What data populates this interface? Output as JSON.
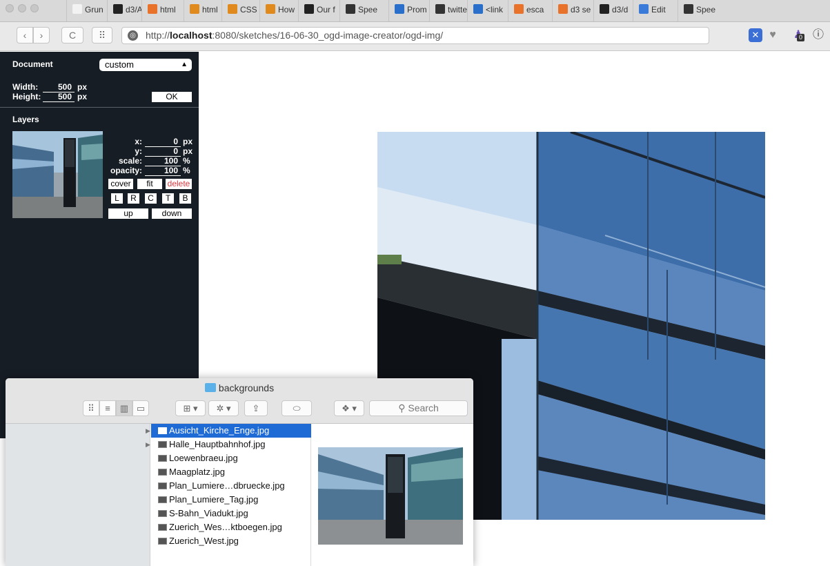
{
  "tabs": [
    {
      "label": "Grun",
      "icon": "document-icon",
      "color": "#f2f2f2"
    },
    {
      "label": "d3/A",
      "icon": "github-icon",
      "color": "#222222"
    },
    {
      "label": "html",
      "icon": "firefox-icon",
      "color": "#e8722a"
    },
    {
      "label": "html",
      "icon": "stackoverflow-icon",
      "color": "#e08a1e"
    },
    {
      "label": "CSS",
      "icon": "stackoverflow-icon",
      "color": "#e08a1e"
    },
    {
      "label": "How",
      "icon": "stackoverflow-icon",
      "color": "#e08a1e"
    },
    {
      "label": "Our f",
      "icon": "code-icon",
      "color": "#222222"
    },
    {
      "label": "Spee",
      "icon": "grid-icon",
      "color": "#333333"
    },
    {
      "label": "Prom",
      "icon": "square-icon",
      "color": "#2a6fc9"
    },
    {
      "label": "twitte",
      "icon": "letter-c-icon",
      "color": "#333333"
    },
    {
      "label": "<link",
      "icon": "square-icon",
      "color": "#2a6fc9"
    },
    {
      "label": "esca",
      "icon": "firefox-icon",
      "color": "#e8722a"
    },
    {
      "label": "d3 se",
      "icon": "firefox-icon",
      "color": "#e8722a"
    },
    {
      "label": "d3/d",
      "icon": "github-icon",
      "color": "#222222"
    },
    {
      "label": "Edit",
      "icon": "codepen-icon",
      "color": "#3a7ad9"
    },
    {
      "label": "Spee",
      "icon": "grid-icon",
      "color": "#333333"
    }
  ],
  "nav": {
    "back": "‹",
    "forward": "›",
    "reload": "C",
    "apps": "⠿",
    "url_prefix": "http://",
    "url_host": "localhost",
    "url_rest": ":8080/sketches/16-06-30_ogd-image-creator/ogd-img/",
    "ext_badge": "0"
  },
  "panel": {
    "document_title": "Document",
    "document_select": "custom",
    "width_label": "Width:",
    "width_value": "500",
    "height_label": "Height:",
    "height_value": "500",
    "unit_px": "px",
    "ok_label": "OK",
    "layers_title": "Layers",
    "x_label": "x:",
    "x_value": "0",
    "y_label": "y:",
    "y_value": "0",
    "scale_label": "scale:",
    "scale_value": "100",
    "opacity_label": "opacity:",
    "opacity_value": "100",
    "unit_pct": "%",
    "cover_label": "cover",
    "fit_label": "fit",
    "delete_label": "delete",
    "align_L": "L",
    "align_R": "R",
    "align_C": "C",
    "align_T": "T",
    "align_B": "B",
    "up_label": "up",
    "down_label": "down"
  },
  "finder": {
    "title": "backgrounds",
    "search_placeholder": "Search",
    "files": [
      {
        "name": "Ausicht_Kirche_Enge.jpg",
        "selected": true,
        "disclosure": true
      },
      {
        "name": "Halle_Hauptbahnhof.jpg",
        "selected": false,
        "disclosure": true
      },
      {
        "name": "Loewenbraeu.jpg",
        "selected": false,
        "disclosure": false
      },
      {
        "name": "Maagplatz.jpg",
        "selected": false,
        "disclosure": false
      },
      {
        "name": "Plan_Lumiere…dbruecke.jpg",
        "selected": false,
        "disclosure": false
      },
      {
        "name": "Plan_Lumiere_Tag.jpg",
        "selected": false,
        "disclosure": false
      },
      {
        "name": "S-Bahn_Viadukt.jpg",
        "selected": false,
        "disclosure": false
      },
      {
        "name": "Zuerich_Wes…ktboegen.jpg",
        "selected": false,
        "disclosure": false
      },
      {
        "name": "Zuerich_West.jpg",
        "selected": false,
        "disclosure": false
      }
    ]
  },
  "colors": {
    "panel_bg": "#171d25",
    "delete_red": "#e0383f",
    "selection_blue": "#1f6bd6"
  }
}
